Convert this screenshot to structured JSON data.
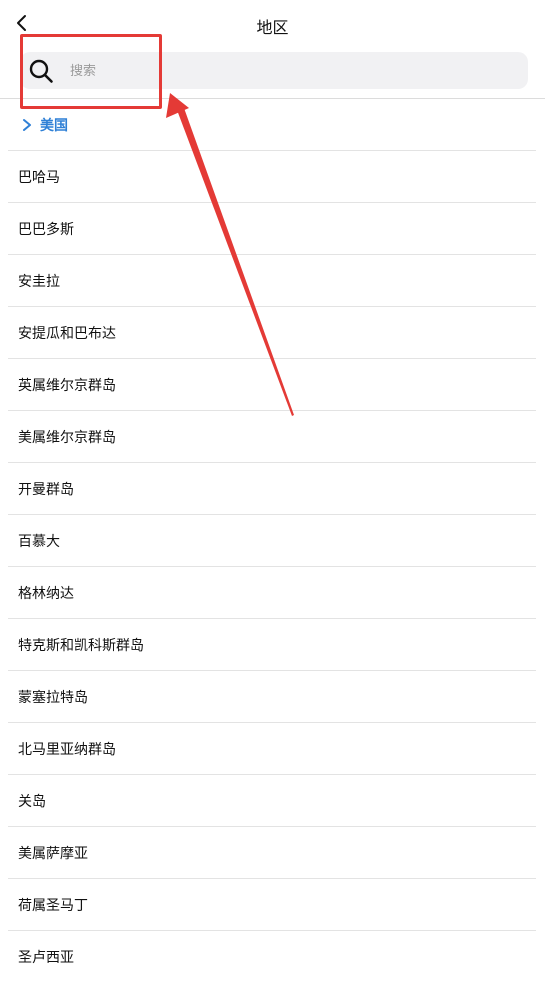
{
  "header": {
    "title": "地区",
    "back_icon": "chevron-left-icon"
  },
  "search": {
    "placeholder": "搜索",
    "value": "",
    "icon": "search-icon"
  },
  "selected_region": {
    "label": "美国",
    "icon": "chevron-right-icon",
    "color": "#2f80d6"
  },
  "regions": [
    "巴哈马",
    "巴巴多斯",
    "安圭拉",
    "安提瓜和巴布达",
    "英属维尔京群岛",
    "美属维尔京群岛",
    "开曼群岛",
    "百慕大",
    "格林纳达",
    "特克斯和凯科斯群岛",
    "蒙塞拉特岛",
    "北马里亚纳群岛",
    "关岛",
    "美属萨摩亚",
    "荷属圣马丁",
    "圣卢西亚"
  ],
  "annotation": {
    "color": "#e43a36"
  }
}
